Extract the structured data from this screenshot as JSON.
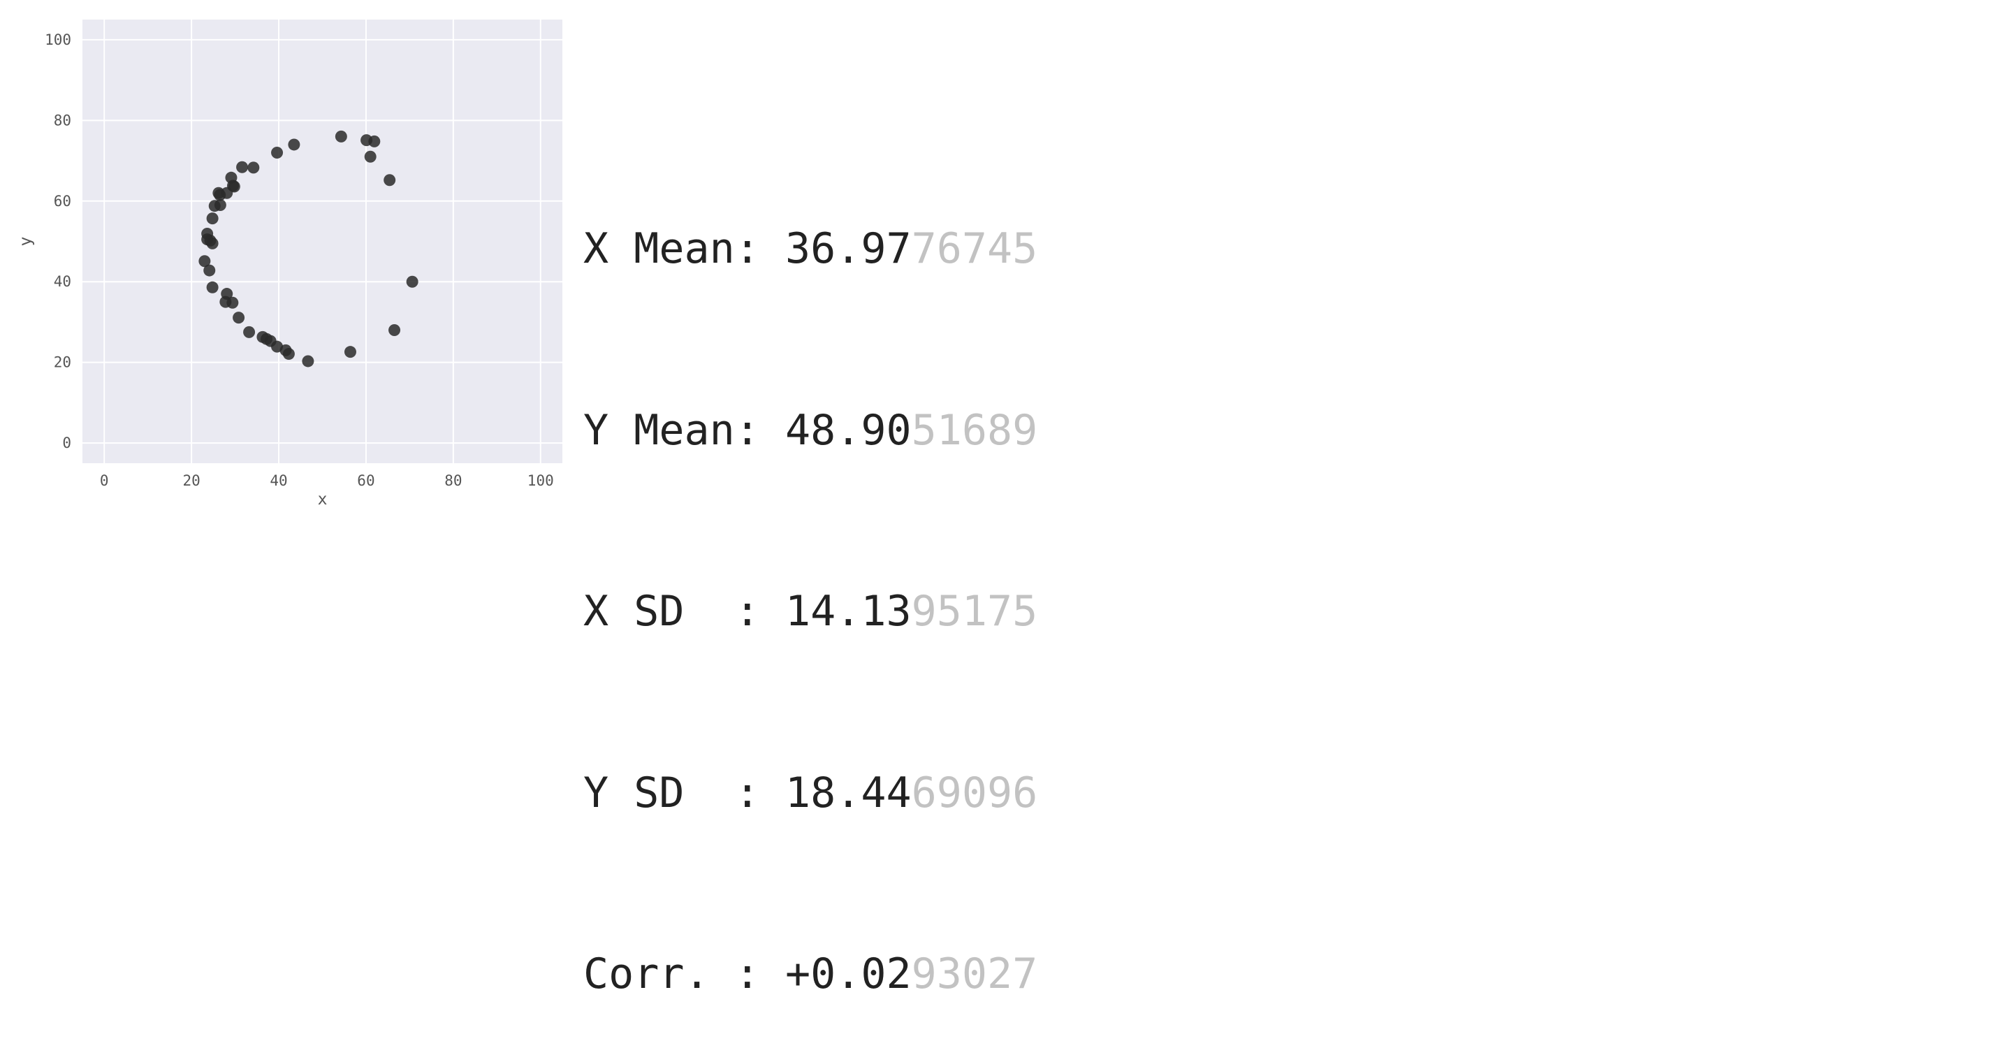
{
  "chart_data": {
    "type": "scatter",
    "xlabel": "x",
    "ylabel": "y",
    "xlim": [
      -5,
      105
    ],
    "ylim": [
      -5,
      105
    ],
    "xticks": [
      0,
      20,
      40,
      60,
      80,
      100
    ],
    "yticks": [
      0,
      20,
      40,
      60,
      80,
      100
    ],
    "grid": true,
    "point_color": "#2a2a2a",
    "background_color": "#eaeaf2",
    "grid_color": "#ffffff",
    "points": [
      [
        43.5,
        74.0
      ],
      [
        54.3,
        76.0
      ],
      [
        60.1,
        75.1
      ],
      [
        61.9,
        74.8
      ],
      [
        61.0,
        71.0
      ],
      [
        65.4,
        65.2
      ],
      [
        39.6,
        72.0
      ],
      [
        34.2,
        68.3
      ],
      [
        31.6,
        68.4
      ],
      [
        29.1,
        65.8
      ],
      [
        29.5,
        63.8
      ],
      [
        29.8,
        63.6
      ],
      [
        28.1,
        62.0
      ],
      [
        26.2,
        62.0
      ],
      [
        26.5,
        61.5
      ],
      [
        26.6,
        59.0
      ],
      [
        25.3,
        58.8
      ],
      [
        24.8,
        55.7
      ],
      [
        23.6,
        51.9
      ],
      [
        23.6,
        50.5
      ],
      [
        24.3,
        50.2
      ],
      [
        24.8,
        49.5
      ],
      [
        23.0,
        45.1
      ],
      [
        24.1,
        42.8
      ],
      [
        24.8,
        38.6
      ],
      [
        28.1,
        37.0
      ],
      [
        27.8,
        35.0
      ],
      [
        29.4,
        34.8
      ],
      [
        30.8,
        31.1
      ],
      [
        33.2,
        27.5
      ],
      [
        36.3,
        26.3
      ],
      [
        37.2,
        25.8
      ],
      [
        38.1,
        25.3
      ],
      [
        39.6,
        23.9
      ],
      [
        41.6,
        23.0
      ],
      [
        42.3,
        22.1
      ],
      [
        46.7,
        20.3
      ],
      [
        56.4,
        22.6
      ],
      [
        66.5,
        28.0
      ],
      [
        70.6,
        40.0
      ]
    ]
  },
  "stats": [
    {
      "label": "X Mean: ",
      "bold": "36.97",
      "faded": "76745"
    },
    {
      "label": "Y Mean: ",
      "bold": "48.90",
      "faded": "51689"
    },
    {
      "label": "X SD  : ",
      "bold": "14.13",
      "faded": "95175"
    },
    {
      "label": "Y SD  : ",
      "bold": "18.44",
      "faded": "69096"
    },
    {
      "label": "Corr. : ",
      "bold": "+0.02",
      "faded": "93027"
    }
  ]
}
